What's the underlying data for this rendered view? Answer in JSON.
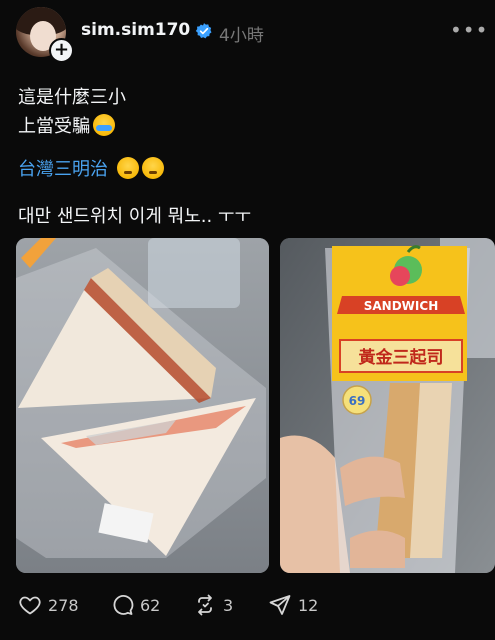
{
  "post": {
    "username": "sim.sim170",
    "timestamp": "4小時",
    "text_line1": "這是什麼三小",
    "text_line2": "上當受騙",
    "hashtag": "台灣三明治",
    "text_line4": "대만 샌드위치 이게 뭐노.. ㅜㅜ",
    "photo2_package_label": "SANDWICH",
    "photo2_product_name": "黃金三起司",
    "photo2_weight": "69"
  },
  "actions": {
    "likes": "278",
    "comments": "62",
    "reposts": "3",
    "shares": "12"
  },
  "icons": [
    "plus-icon",
    "verified-badge-icon",
    "more-icon",
    "heart-icon",
    "comment-icon",
    "repost-icon",
    "share-icon"
  ],
  "colors": {
    "background": "#0a0a0a",
    "hashtag": "#4aa3f0",
    "verified": "#3aa0ff"
  }
}
